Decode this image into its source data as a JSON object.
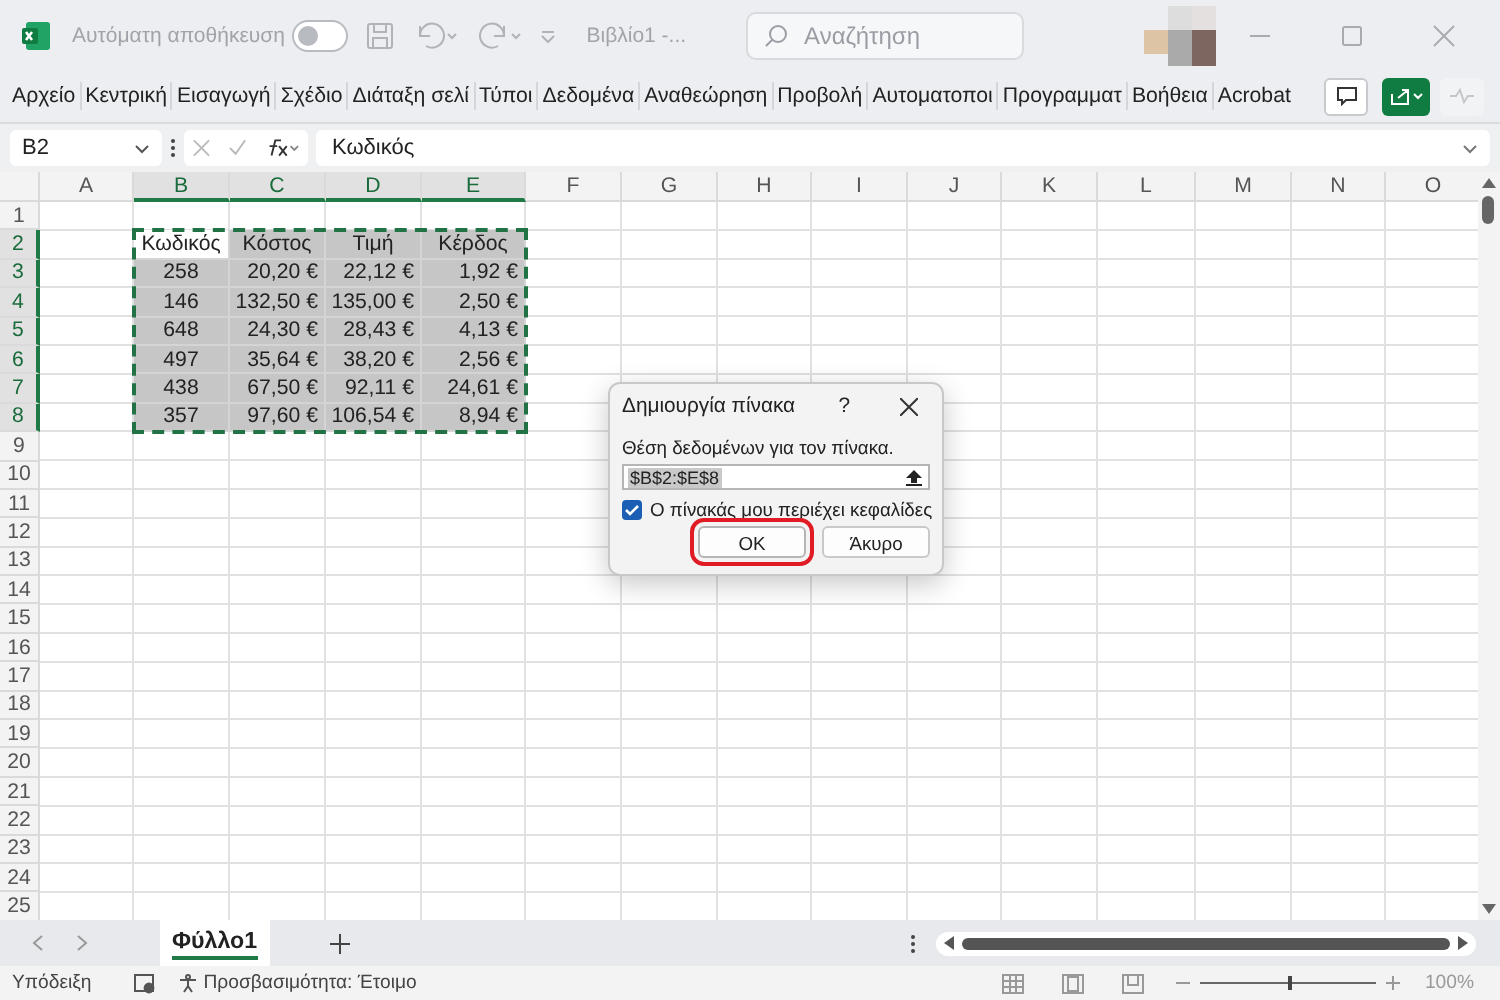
{
  "title_bar": {
    "autosave_label": "Αυτόματη αποθήκευση",
    "autosave_on": false,
    "document_title": "Βιβλίο1 -...",
    "search_placeholder": "Αναζήτηση"
  },
  "ribbon_tabs": [
    "Αρχείο",
    "Κεντρική",
    "Εισαγωγή",
    "Σχέδιο",
    "Διάταξη σελί",
    "Τύποι",
    "Δεδομένα",
    "Αναθεώρηση",
    "Προβολή",
    "Αυτοματοποι",
    "Προγραμματ",
    "Βοήθεια",
    "Acrobat"
  ],
  "formula_bar": {
    "name_box": "B2",
    "formula": "Κωδικός"
  },
  "sheet": {
    "columns": [
      "A",
      "B",
      "C",
      "D",
      "E",
      "F",
      "G",
      "H",
      "I",
      "J",
      "K",
      "L",
      "M",
      "N",
      "O"
    ],
    "rows": [
      "1",
      "2",
      "3",
      "4",
      "5",
      "6",
      "7",
      "8",
      "9",
      "10",
      "11",
      "12",
      "13",
      "14",
      "15",
      "16",
      "17",
      "18",
      "19",
      "20",
      "21",
      "22",
      "23",
      "24",
      "25"
    ],
    "table": {
      "header": [
        "Κωδικός",
        "Κόστος",
        "Τιμή",
        "Κέρδος"
      ],
      "rows": [
        [
          "258",
          "20,20 €",
          "22,12 €",
          "1,92 €"
        ],
        [
          "146",
          "132,50 €",
          "135,00 €",
          "2,50 €"
        ],
        [
          "648",
          "24,30 €",
          "28,43 €",
          "4,13 €"
        ],
        [
          "497",
          "35,64 €",
          "38,20 €",
          "2,56 €"
        ],
        [
          "438",
          "67,50 €",
          "92,11 €",
          "24,61 €"
        ],
        [
          "357",
          "97,60 €",
          "106,54 €",
          "8,94 €"
        ]
      ]
    }
  },
  "dialog": {
    "title": "Δημιουργία πίνακα",
    "help": "?",
    "range_label": "Θέση δεδομένων για τον πίνακα.",
    "range_value": "$B$2:$E$8",
    "headers_checkbox": {
      "label": "Ο πίνακάς μου περιέχει κεφαλίδες",
      "checked": true
    },
    "buttons": [
      {
        "label": "OK",
        "highlighted": true
      },
      {
        "label": "Άκυρο",
        "highlighted": false
      }
    ]
  },
  "sheet_tabs": [
    {
      "label": "Φύλλο1",
      "selected": true
    }
  ],
  "status_bar": {
    "mode": "Υπόδειξη",
    "accessibility": "Προσβασιμότητα: Έτοιμο",
    "zoom_slider": {
      "level": 0.5
    },
    "zoom": "100%"
  }
}
